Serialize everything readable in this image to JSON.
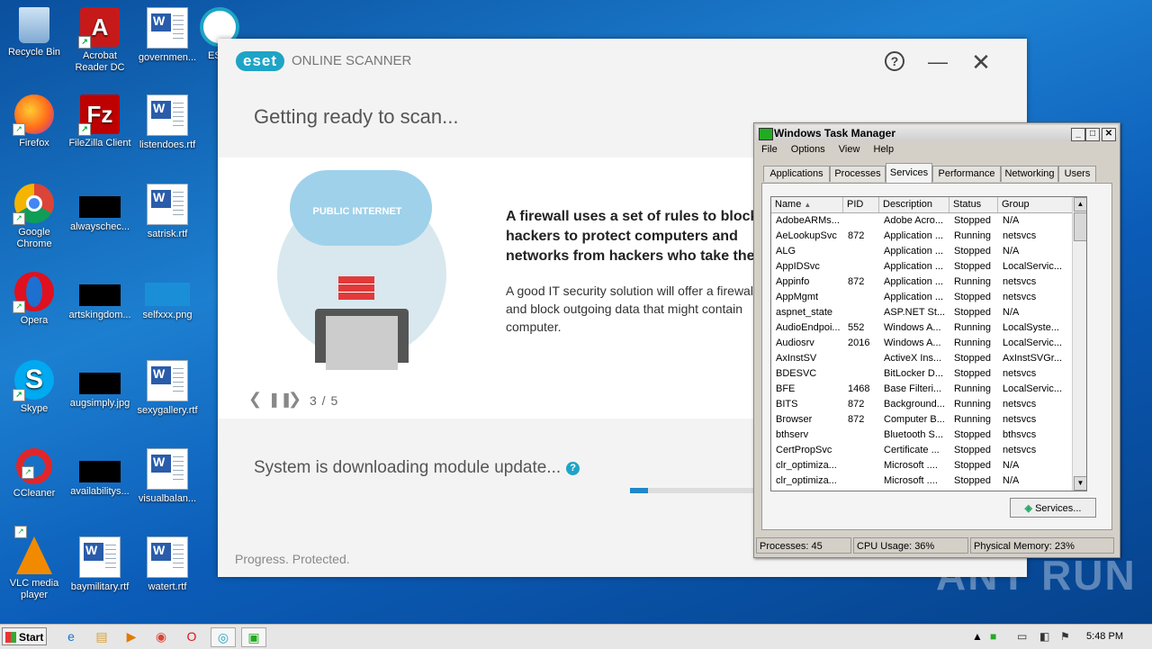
{
  "desktop": {
    "icons": [
      {
        "label": "Recycle Bin"
      },
      {
        "label": "Acrobat Reader DC"
      },
      {
        "label": "governmen..."
      },
      {
        "label": "ESE"
      },
      {
        "label": "Firefox"
      },
      {
        "label": "FileZilla Client"
      },
      {
        "label": "listendoes.rtf"
      },
      {
        "label": "Google Chrome"
      },
      {
        "label": "alwayschec..."
      },
      {
        "label": "satrisk.rtf"
      },
      {
        "label": "Opera"
      },
      {
        "label": "artskingdom..."
      },
      {
        "label": "selfxxx.png"
      },
      {
        "label": "Skype"
      },
      {
        "label": "augsimply.jpg"
      },
      {
        "label": "sexygallery.rtf"
      },
      {
        "label": "CCleaner"
      },
      {
        "label": "availabilitys..."
      },
      {
        "label": "visualbalan..."
      },
      {
        "label": "VLC media player"
      },
      {
        "label": "baymilitary.rtf"
      },
      {
        "label": "watert.rtf"
      }
    ]
  },
  "eset": {
    "logo": "eset",
    "app_name": "ONLINE SCANNER",
    "title": "Getting ready to scan...",
    "slide": {
      "cloud_label": "PUBLIC INTERNET",
      "headline": "A firewall uses a set of rules to block hackers to protect computers and networks from hackers who take them over or misuse them.",
      "body": "A good IT security solution will offer a firewall – and block outgoing data that might contain computer.",
      "counter": "3 / 5"
    },
    "status_text": "System is downloading module update...",
    "progress_fraction": 0.14,
    "footer": "Progress. Protected."
  },
  "taskmanager": {
    "title": "Windows Task Manager",
    "menu": [
      "File",
      "Options",
      "View",
      "Help"
    ],
    "tabs": [
      "Applications",
      "Processes",
      "Services",
      "Performance",
      "Networking",
      "Users"
    ],
    "active_tab": "Services",
    "columns": [
      "Name",
      "PID",
      "Description",
      "Status",
      "Group"
    ],
    "rows": [
      [
        "AdobeARMs...",
        "",
        "Adobe Acro...",
        "Stopped",
        "N/A"
      ],
      [
        "AeLookupSvc",
        "872",
        "Application ...",
        "Running",
        "netsvcs"
      ],
      [
        "ALG",
        "",
        "Application ...",
        "Stopped",
        "N/A"
      ],
      [
        "AppIDSvc",
        "",
        "Application ...",
        "Stopped",
        "LocalServic..."
      ],
      [
        "Appinfo",
        "872",
        "Application ...",
        "Running",
        "netsvcs"
      ],
      [
        "AppMgmt",
        "",
        "Application ...",
        "Stopped",
        "netsvcs"
      ],
      [
        "aspnet_state",
        "",
        "ASP.NET St...",
        "Stopped",
        "N/A"
      ],
      [
        "AudioEndpoi...",
        "552",
        "Windows A...",
        "Running",
        "LocalSyste..."
      ],
      [
        "Audiosrv",
        "2016",
        "Windows A...",
        "Running",
        "LocalServic..."
      ],
      [
        "AxInstSV",
        "",
        "ActiveX Ins...",
        "Stopped",
        "AxInstSVGr..."
      ],
      [
        "BDESVC",
        "",
        "BitLocker D...",
        "Stopped",
        "netsvcs"
      ],
      [
        "BFE",
        "1468",
        "Base Filteri...",
        "Running",
        "LocalServic..."
      ],
      [
        "BITS",
        "872",
        "Background...",
        "Running",
        "netsvcs"
      ],
      [
        "Browser",
        "872",
        "Computer B...",
        "Running",
        "netsvcs"
      ],
      [
        "bthserv",
        "",
        "Bluetooth S...",
        "Stopped",
        "bthsvcs"
      ],
      [
        "CertPropSvc",
        "",
        "Certificate ...",
        "Stopped",
        "netsvcs"
      ],
      [
        "clr_optimiza...",
        "",
        "Microsoft ....",
        "Stopped",
        "N/A"
      ],
      [
        "clr_optimiza...",
        "",
        "Microsoft ....",
        "Stopped",
        "N/A"
      ]
    ],
    "services_button": "Services...",
    "status": {
      "processes": "Processes: 45",
      "cpu": "CPU Usage: 36%",
      "memory": "Physical Memory: 23%"
    }
  },
  "taskbar": {
    "start": "Start",
    "clock": "5:48 PM"
  },
  "watermark": "ANY RUN"
}
